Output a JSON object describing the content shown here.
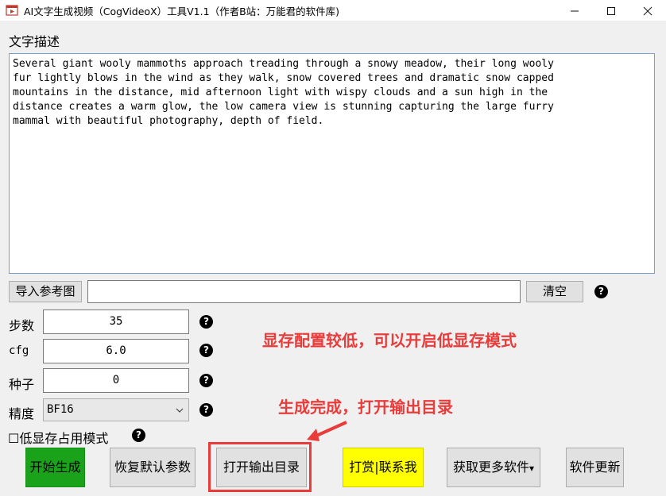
{
  "window": {
    "title": "AI文字生成视频（CogVideoX）工具V1.1（作者B站：万能君的软件库)",
    "minimize_icon": "minimize-icon",
    "maximize_icon": "maximize-icon",
    "close_icon": "close-icon"
  },
  "description": {
    "label": "文字描述",
    "text": "Several giant wooly mammoths approach treading through a snowy meadow, their long wooly\nfur lightly blows in the wind as they walk, snow covered trees and dramatic snow capped\nmountains in the distance, mid afternoon light with wispy clouds and a sun high in the\ndistance creates a warm glow, the low camera view is stunning capturing the large furry\nmammal with beautiful photography, depth of field."
  },
  "reference": {
    "import_label": "导入参考图",
    "path_value": "",
    "clear_label": "清空"
  },
  "params": {
    "steps": {
      "label": "步数",
      "value": "35"
    },
    "cfg": {
      "label": "cfg",
      "value": "6.0"
    },
    "seed": {
      "label": "种子",
      "value": "0"
    },
    "precision": {
      "label": "精度",
      "value": "BF16"
    }
  },
  "low_vram": {
    "checkbox": "☐",
    "label": "低显存占用模式"
  },
  "help_glyph": "?",
  "annotations": {
    "low_vram_hint": "显存配置较低，可以开启低显存模式",
    "done_hint": "生成完成，打开输出目录"
  },
  "buttons": {
    "start": "开始生成",
    "reset": "恢复默认参数",
    "open_output": "打开输出目录",
    "donate": "打赏|联系我",
    "more_software": "获取更多软件",
    "more_arrow": "▾",
    "update": "软件更新"
  },
  "colors": {
    "start_bg": "#1aa31a",
    "donate_bg": "#ffff00",
    "annotation_red": "#ea3b3b",
    "textbox_border": "#7a9fd0"
  }
}
